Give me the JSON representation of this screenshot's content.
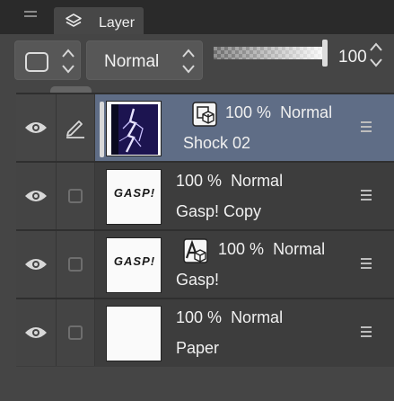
{
  "panel": {
    "title": "Layer"
  },
  "properties": {
    "blend_mode": "Normal",
    "opacity": "100"
  },
  "layer_settings_tools": [
    {
      "name": "clip-to-layer-below-icon",
      "active": true
    },
    {
      "name": "reference-layer-icon",
      "active": false
    },
    {
      "name": "set-selection-layer-icon",
      "active": false
    },
    {
      "name": "lock-layer-icon",
      "active": false
    },
    {
      "name": "lock-transparent-pixels-icon",
      "active": false
    },
    {
      "name": "layer-mask-icon",
      "active": false
    },
    {
      "name": "ruler-icon",
      "active": false
    }
  ],
  "layers": [
    {
      "opacity": "100 %",
      "blend": "Normal",
      "name": "Shock 02",
      "selected": true,
      "editing": true,
      "type_icon": "raster-layer-icon",
      "thumb": "lightning"
    },
    {
      "opacity": "100 %",
      "blend": "Normal",
      "name": "Gasp! Copy",
      "selected": false,
      "editing": false,
      "type_icon": null,
      "thumb": "gasp",
      "thumb_text": "GASP!"
    },
    {
      "opacity": "100 %",
      "blend": "Normal",
      "name": "Gasp!",
      "selected": false,
      "editing": false,
      "type_icon": "vector-layer-icon",
      "thumb": "gasp",
      "thumb_text": "GASP!"
    },
    {
      "opacity": "100 %",
      "blend": "Normal",
      "name": "Paper",
      "selected": false,
      "editing": false,
      "type_icon": null,
      "thumb": "paper"
    }
  ]
}
